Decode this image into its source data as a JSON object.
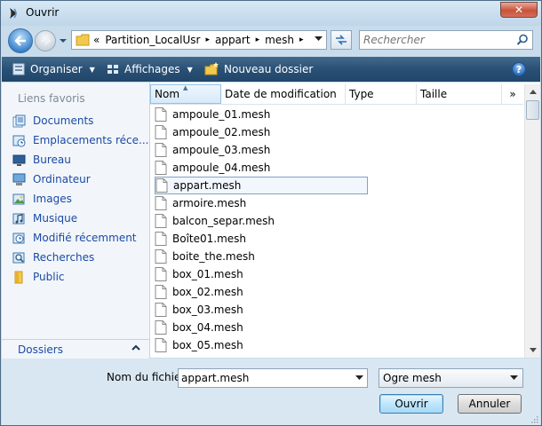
{
  "window": {
    "title": "Ouvrir"
  },
  "nav": {
    "address_overflow": "«",
    "breadcrumb": [
      "Partition_LocalUsr",
      "appart",
      "mesh"
    ],
    "search_placeholder": "Rechercher"
  },
  "toolbar": {
    "organize_label": "Organiser",
    "views_label": "Affichages",
    "new_folder_label": "Nouveau dossier",
    "help_label": "?"
  },
  "sidebar": {
    "heading": "Liens favoris",
    "items": [
      {
        "label": "Documents",
        "icon": "documents-icon"
      },
      {
        "label": "Emplacements réce...",
        "icon": "recent-places-icon"
      },
      {
        "label": "Bureau",
        "icon": "desktop-icon"
      },
      {
        "label": "Ordinateur",
        "icon": "computer-icon"
      },
      {
        "label": "Images",
        "icon": "pictures-icon"
      },
      {
        "label": "Musique",
        "icon": "music-icon"
      },
      {
        "label": "Modifié récemment",
        "icon": "recently-changed-icon"
      },
      {
        "label": "Recherches",
        "icon": "searches-icon"
      },
      {
        "label": "Public",
        "icon": "public-folder-icon"
      }
    ],
    "folders_label": "Dossiers"
  },
  "filelist": {
    "columns": [
      "Nom",
      "Date de modification",
      "Type",
      "Taille"
    ],
    "more_columns": "»",
    "files": [
      "ampoule_01.mesh",
      "ampoule_02.mesh",
      "ampoule_03.mesh",
      "ampoule_04.mesh",
      "appart.mesh",
      "armoire.mesh",
      "balcon_separ.mesh",
      "Boîte01.mesh",
      "boite_the.mesh",
      "box_01.mesh",
      "box_02.mesh",
      "box_03.mesh",
      "box_04.mesh",
      "box_05.mesh"
    ],
    "selected_file": "appart.mesh"
  },
  "bottom": {
    "filename_label": "Nom du fichier :",
    "filename_value": "appart.mesh",
    "filetype_value": "Ogre mesh",
    "open_label": "Ouvrir",
    "cancel_label": "Annuler"
  },
  "colors": {
    "toolbar_bg": "#2a5075",
    "link_blue": "#1b4aa5",
    "window_frame": "#c8dceb"
  }
}
